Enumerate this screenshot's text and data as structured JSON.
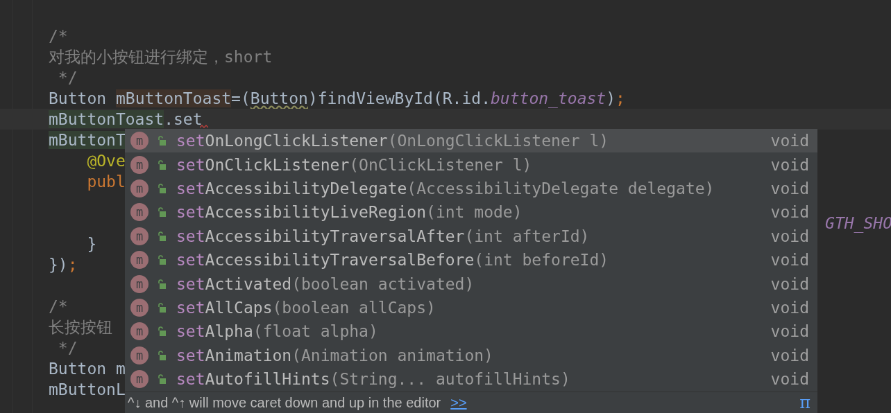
{
  "code_lines": [
    {
      "tokens": [
        {
          "text": "/*",
          "kind": "comment"
        }
      ]
    },
    {
      "tokens": [
        {
          "text": "对我的小按钮进行绑定，short",
          "kind": "comment"
        }
      ]
    },
    {
      "tokens": [
        {
          "text": " */",
          "kind": "comment"
        }
      ]
    },
    {
      "tokens": [
        {
          "text": "Button ",
          "kind": "plain"
        },
        {
          "text": "mButtonToast",
          "kind": "write_highlight"
        },
        {
          "text": "=(",
          "kind": "plain"
        },
        {
          "text": "Button",
          "kind": "warning"
        },
        {
          "text": ")findViewById(R.id.",
          "kind": "plain"
        },
        {
          "text": "button_toast",
          "kind": "static"
        },
        {
          "text": ")",
          "kind": "plain"
        },
        {
          "text": ";",
          "kind": "keyword"
        }
      ]
    },
    {
      "current": true,
      "error_squiggle": true,
      "tokens": [
        {
          "text": "mButtonToast",
          "kind": "read_highlight"
        },
        {
          "text": ".set",
          "kind": "plain"
        }
      ]
    },
    {
      "tokens": [
        {
          "text": "mButtonT",
          "kind": "read_highlight"
        }
      ],
      "children": [
        {
          "tokens": [
            {
              "text": "@Ove",
              "kind": "annotation"
            }
          ]
        },
        {
          "tokens": [
            {
              "text": "publ",
              "kind": "keyword"
            }
          ],
          "children": [
            {
              "kind": "covered",
              "gap_before": true,
              "tokens": [
                {
                  "text": "GTH_SHO",
                  "kind": "static"
                }
              ]
            }
          ]
        },
        {
          "tokens": [
            {
              "text": "}",
              "kind": "plain"
            }
          ]
        }
      ]
    },
    {
      "tokens": [
        {
          "text": "})",
          "kind": "plain"
        },
        {
          "text": ";",
          "kind": "keyword"
        }
      ]
    },
    {
      "gap_before": true,
      "tokens": [
        {
          "text": "/*",
          "kind": "comment"
        }
      ]
    },
    {
      "tokens": [
        {
          "text": "长按按钮",
          "kind": "comment"
        }
      ]
    },
    {
      "tokens": [
        {
          "text": " */",
          "kind": "comment"
        }
      ]
    },
    {
      "tokens": [
        {
          "text": "Button m",
          "kind": "plain"
        }
      ]
    },
    {
      "tokens": [
        {
          "text": "mButtonL",
          "kind": "plain"
        }
      ]
    }
  ],
  "completion": {
    "items": [
      {
        "icon": "m",
        "match": "set",
        "name": "OnLongClickListener",
        "params": "(OnLongClickListener l)",
        "type": "void",
        "selected": true
      },
      {
        "icon": "m",
        "match": "set",
        "name": "OnClickListener",
        "params": "(OnClickListener l)",
        "type": "void",
        "selected": false
      },
      {
        "icon": "m",
        "match": "set",
        "name": "AccessibilityDelegate",
        "params": "(AccessibilityDelegate delegate)",
        "type": "void",
        "selected": false
      },
      {
        "icon": "m",
        "match": "set",
        "name": "AccessibilityLiveRegion",
        "params": "(int mode)",
        "type": "void",
        "selected": false
      },
      {
        "icon": "m",
        "match": "set",
        "name": "AccessibilityTraversalAfter",
        "params": "(int afterId)",
        "type": "void",
        "selected": false
      },
      {
        "icon": "m",
        "match": "set",
        "name": "AccessibilityTraversalBefore",
        "params": "(int beforeId)",
        "type": "void",
        "selected": false
      },
      {
        "icon": "m",
        "match": "set",
        "name": "Activated",
        "params": "(boolean activated)",
        "type": "void",
        "selected": false
      },
      {
        "icon": "m",
        "match": "set",
        "name": "AllCaps",
        "params": "(boolean allCaps)",
        "type": "void",
        "selected": false
      },
      {
        "icon": "m",
        "match": "set",
        "name": "Alpha",
        "params": "(float alpha)",
        "type": "void",
        "selected": false
      },
      {
        "icon": "m",
        "match": "set",
        "name": "Animation",
        "params": "(Animation animation)",
        "type": "void",
        "selected": false
      },
      {
        "icon": "m",
        "match": "set",
        "name": "AutofillHints",
        "params": "(String... autofillHints)",
        "type": "void",
        "selected": false
      }
    ],
    "footer": {
      "hint": "^↓ and ^↑ will move caret down and up in the editor",
      "link": ">>",
      "symbol": "π"
    }
  }
}
